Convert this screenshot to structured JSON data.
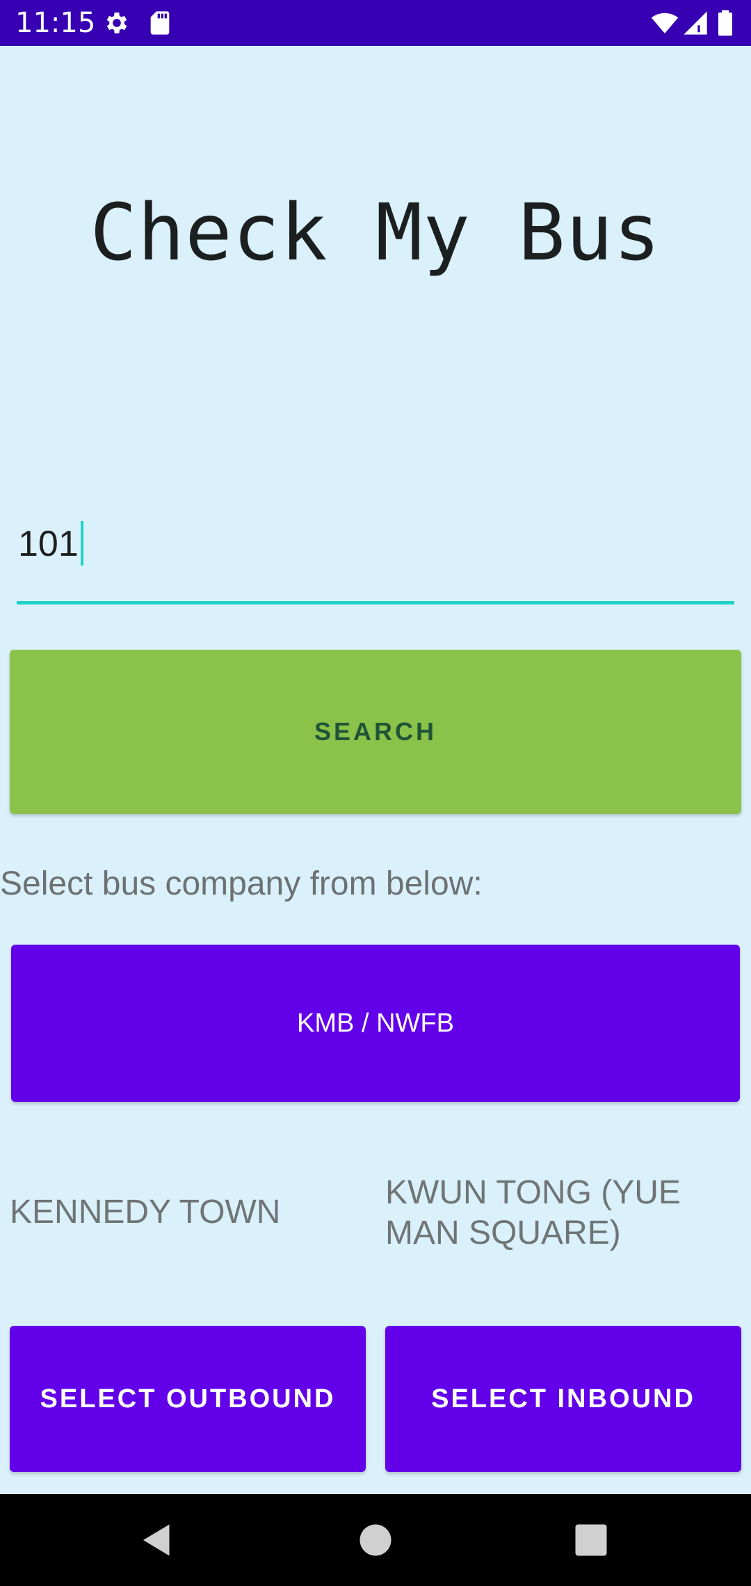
{
  "status_bar": {
    "time": "11:15",
    "icons": [
      "settings-icon",
      "sd-card-icon",
      "wifi-icon",
      "signal-icon",
      "battery-icon"
    ]
  },
  "app": {
    "title": "Check My Bus"
  },
  "search": {
    "route_value": "101",
    "button_label": "SEARCH"
  },
  "company": {
    "prompt": "Select bus company from below:",
    "button_label": "KMB / NWFB"
  },
  "directions": {
    "outbound_destination": "KENNEDY TOWN",
    "inbound_destination": "KWUN TONG (YUE MAN SQUARE)",
    "outbound_button": "SELECT OUTBOUND",
    "inbound_button": "SELECT INBOUND"
  },
  "navigation": {
    "buttons": [
      "back-icon",
      "home-icon",
      "recents-icon"
    ]
  },
  "colors": {
    "status_bar": "#3700b3",
    "background": "#daf1fc",
    "accent": "#1ed3c4",
    "search_button": "#8bc34a",
    "primary_button": "#6200ea"
  }
}
